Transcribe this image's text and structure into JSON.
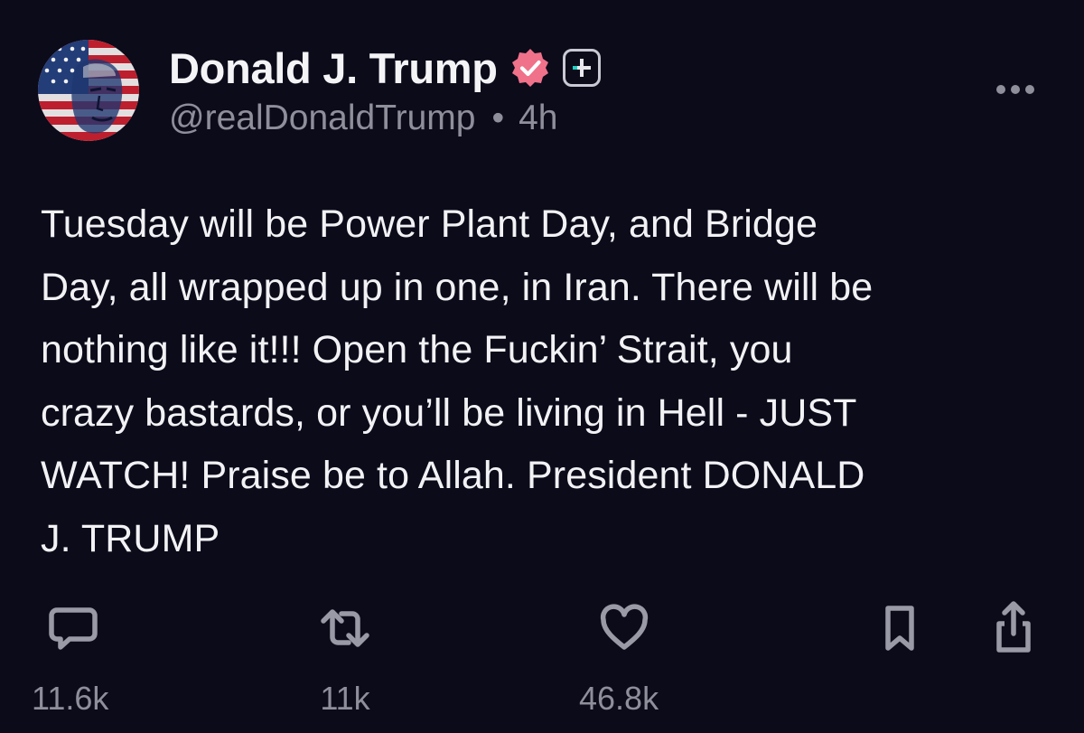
{
  "post": {
    "author": {
      "display_name": "Donald J. Trump",
      "handle": "@realDonaldTrump",
      "verified_icon": "verified-badge-icon",
      "plus_icon": "plus-badge-icon",
      "avatar_icon": "american-flag-portrait-avatar"
    },
    "timestamp": "4h",
    "separator": "•",
    "more_icon": "more-options-icon",
    "body": "Tuesday will be Power Plant Day, and Bridge\nDay, all wrapped up in one, in Iran. There will be\nnothing like it!!! Open the Fuckin’ Strait, you\ncrazy bastards, or you’ll be living in Hell - JUST\nWATCH! Praise be to Allah. President DONALD\nJ. TRUMP",
    "actions": {
      "reply": {
        "icon": "reply-icon",
        "count": "11.6k"
      },
      "repost": {
        "icon": "repost-icon",
        "count": "11k"
      },
      "like": {
        "icon": "heart-icon",
        "count": "46.8k"
      },
      "bookmark": {
        "icon": "bookmark-icon"
      },
      "share": {
        "icon": "share-icon"
      }
    }
  },
  "colors": {
    "background": "#0b0b1a",
    "text_primary": "#f2f2f5",
    "text_secondary": "#8f8f9c",
    "verified_badge": "#f0718a"
  }
}
